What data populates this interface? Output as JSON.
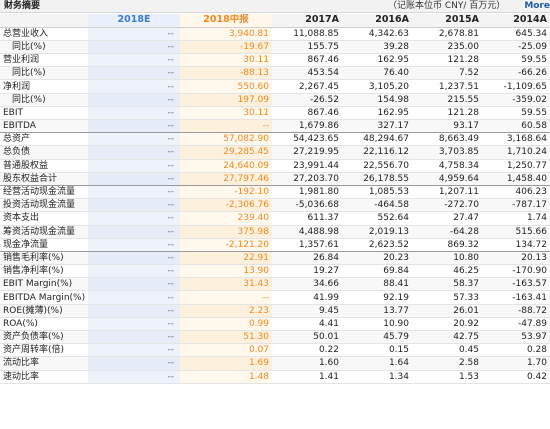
{
  "header": {
    "title": "财务摘要",
    "unit": "（记账本位币 CNY/ 百万元）",
    "more": "More"
  },
  "columns": [
    "",
    "2018E",
    "2018中报",
    "2017A",
    "2016A",
    "2015A",
    "2014A"
  ],
  "rows": [
    {
      "label": "总营业收入",
      "indent": false,
      "values": [
        "--",
        "3,940.81",
        "11,088.85",
        "4,342.63",
        "2,678.81",
        "645.34"
      ]
    },
    {
      "label": "同比(%)",
      "indent": true,
      "values": [
        "--",
        "-19.67",
        "155.75",
        "39.28",
        "235.00",
        "-25.09"
      ]
    },
    {
      "label": "营业利润",
      "indent": false,
      "values": [
        "--",
        "30.11",
        "867.46",
        "162.95",
        "121.28",
        "59.55"
      ]
    },
    {
      "label": "同比(%)",
      "indent": true,
      "values": [
        "--",
        "-88.13",
        "453.54",
        "76.40",
        "7.52",
        "-66.26"
      ]
    },
    {
      "label": "净利润",
      "indent": false,
      "values": [
        "--",
        "550.60",
        "2,267.45",
        "3,105.20",
        "1,237.51",
        "-1,109.65"
      ]
    },
    {
      "label": "同比(%)",
      "indent": true,
      "values": [
        "--",
        "197.09",
        "-26.52",
        "154.98",
        "215.55",
        "-359.02"
      ]
    },
    {
      "label": "EBIT",
      "indent": false,
      "values": [
        "--",
        "30.11",
        "867.46",
        "162.95",
        "121.28",
        "59.55"
      ]
    },
    {
      "label": "EBITDA",
      "indent": false,
      "values": [
        "--",
        "--",
        "1,679.86",
        "327.17",
        "93.17",
        "60.58"
      ]
    },
    {
      "label": "总资产",
      "indent": false,
      "values": [
        "--",
        "57,082.90",
        "54,423.65",
        "48,294.67",
        "8,663.49",
        "3,168.64"
      ]
    },
    {
      "label": "总负债",
      "indent": false,
      "values": [
        "--",
        "29,285.45",
        "27,219.95",
        "22,116.12",
        "3,703.85",
        "1,710.24"
      ]
    },
    {
      "label": "普通股权益",
      "indent": false,
      "values": [
        "--",
        "24,640.09",
        "23,991.44",
        "22,556.70",
        "4,758.34",
        "1,250.77"
      ]
    },
    {
      "label": "股东权益合计",
      "indent": false,
      "values": [
        "--",
        "27,797.46",
        "27,203.70",
        "26,178.55",
        "4,959.64",
        "1,458.40"
      ]
    },
    {
      "label": "经营活动现金流量",
      "indent": false,
      "values": [
        "--",
        "-192.10",
        "1,981.80",
        "1,085.53",
        "1,207.11",
        "406.23"
      ]
    },
    {
      "label": "投资活动现金流量",
      "indent": false,
      "values": [
        "--",
        "-2,306.76",
        "-5,036.68",
        "-464.58",
        "-272.70",
        "-787.17"
      ]
    },
    {
      "label": "资本支出",
      "indent": false,
      "values": [
        "--",
        "239.40",
        "611.37",
        "552.64",
        "27.47",
        "1.74"
      ]
    },
    {
      "label": "筹资活动现金流量",
      "indent": false,
      "values": [
        "--",
        "375.98",
        "4,488.98",
        "2,019.13",
        "-64.28",
        "515.66"
      ]
    },
    {
      "label": "现金净流量",
      "indent": false,
      "values": [
        "--",
        "-2,121.20",
        "1,357.61",
        "2,623.52",
        "869.32",
        "134.72"
      ]
    },
    {
      "label": "销售毛利率(%)",
      "indent": false,
      "values": [
        "--",
        "22.91",
        "26.84",
        "20.23",
        "10.80",
        "20.13"
      ]
    },
    {
      "label": "销售净利率(%)",
      "indent": false,
      "values": [
        "--",
        "13.90",
        "19.27",
        "69.84",
        "46.25",
        "-170.90"
      ]
    },
    {
      "label": "EBIT Margin(%)",
      "indent": false,
      "values": [
        "--",
        "31.43",
        "34.66",
        "88.41",
        "58.37",
        "-163.57"
      ]
    },
    {
      "label": "EBITDA Margin(%)",
      "indent": false,
      "values": [
        "--",
        "--",
        "41.99",
        "92.19",
        "57.33",
        "-163.41"
      ]
    },
    {
      "label": "ROE(摊薄)(%)",
      "indent": false,
      "values": [
        "--",
        "2.23",
        "9.45",
        "13.77",
        "26.01",
        "-88.72"
      ]
    },
    {
      "label": "ROA(%)",
      "indent": false,
      "values": [
        "--",
        "0.99",
        "4.41",
        "10.90",
        "20.92",
        "-47.89"
      ]
    },
    {
      "label": "资产负债率(%)",
      "indent": false,
      "values": [
        "--",
        "51.30",
        "50.01",
        "45.79",
        "42.75",
        "53.97"
      ]
    },
    {
      "label": "资产周转率(倍)",
      "indent": false,
      "values": [
        "--",
        "0.07",
        "0.22",
        "0.15",
        "0.45",
        "0.28"
      ]
    },
    {
      "label": "流动比率",
      "indent": false,
      "values": [
        "--",
        "1.69",
        "1.60",
        "1.64",
        "2.58",
        "1.70"
      ]
    },
    {
      "label": "速动比率",
      "indent": false,
      "values": [
        "--",
        "1.48",
        "1.41",
        "1.34",
        "1.53",
        "0.42"
      ]
    }
  ]
}
